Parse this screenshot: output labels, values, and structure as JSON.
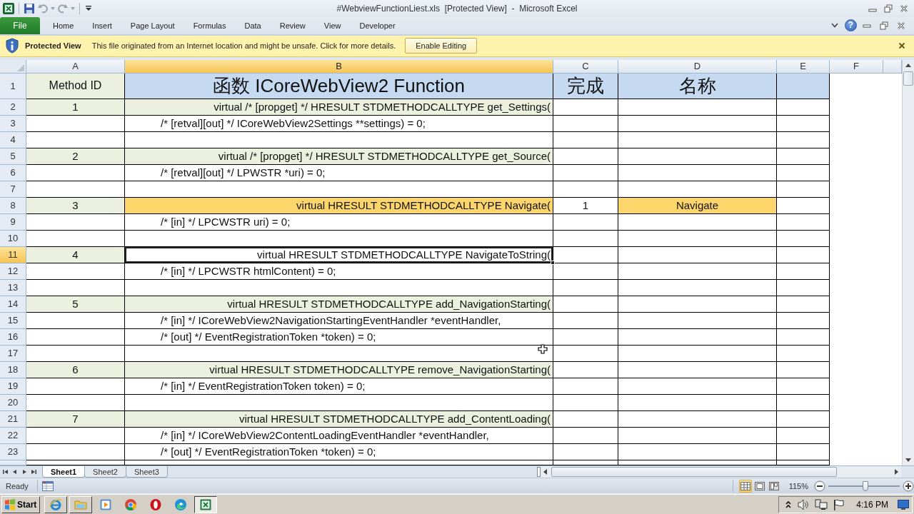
{
  "window": {
    "title": "#WebviewFunctionLiest.xls  [Protected View]  -  Microsoft Excel"
  },
  "ribbon": {
    "file_tab": "File",
    "tabs": [
      "Home",
      "Insert",
      "Page Layout",
      "Formulas",
      "Data",
      "Review",
      "View",
      "Developer"
    ],
    "help": "?"
  },
  "protected_view": {
    "title": "Protected View",
    "message": "This file originated from an Internet location and might be unsafe. Click for more details.",
    "button": "Enable Editing"
  },
  "columns": [
    {
      "label": "A",
      "selected": false
    },
    {
      "label": "B",
      "selected": true
    },
    {
      "label": "C",
      "selected": false
    },
    {
      "label": "D",
      "selected": false
    },
    {
      "label": "E",
      "selected": false
    },
    {
      "label": "F",
      "selected": false
    }
  ],
  "rows": [
    {
      "number": "1",
      "kind": "header",
      "selected": false,
      "highlighted": false,
      "method_id": "Method ID",
      "function": "函数 ICoreWebView2 Function",
      "done": "完成",
      "name": "名称"
    },
    {
      "number": "2",
      "kind": "method",
      "selected": false,
      "highlighted": false,
      "method_id": "1",
      "function": "virtual /* [propget] */ HRESULT STDMETHODCALLTYPE get_Settings("
    },
    {
      "number": "3",
      "kind": "param",
      "selected": false,
      "highlighted": false,
      "function": "/* [retval][out] */ ICoreWebView2Settings **settings) = 0;"
    },
    {
      "number": "4",
      "kind": "blank",
      "selected": false,
      "highlighted": false
    },
    {
      "number": "5",
      "kind": "method",
      "selected": false,
      "highlighted": false,
      "method_id": "2",
      "function": "virtual /* [propget] */ HRESULT STDMETHODCALLTYPE get_Source("
    },
    {
      "number": "6",
      "kind": "param",
      "selected": false,
      "highlighted": false,
      "function": "/* [retval][out] */ LPWSTR *uri) = 0;"
    },
    {
      "number": "7",
      "kind": "blank",
      "selected": false,
      "highlighted": false
    },
    {
      "number": "8",
      "kind": "method",
      "selected": false,
      "highlighted": true,
      "method_id": "3",
      "function": "virtual HRESULT STDMETHODCALLTYPE Navigate(",
      "done": "1",
      "name": "Navigate"
    },
    {
      "number": "9",
      "kind": "param",
      "selected": false,
      "highlighted": false,
      "function": "/* [in] */ LPCWSTR uri) = 0;"
    },
    {
      "number": "10",
      "kind": "blank",
      "selected": false,
      "highlighted": false
    },
    {
      "number": "11",
      "kind": "method",
      "selected": true,
      "highlighted": false,
      "method_id": "4",
      "function": "virtual HRESULT STDMETHODCALLTYPE NavigateToString("
    },
    {
      "number": "12",
      "kind": "param",
      "selected": false,
      "highlighted": false,
      "function": "/* [in] */ LPCWSTR htmlContent) = 0;"
    },
    {
      "number": "13",
      "kind": "blank",
      "selected": false,
      "highlighted": false
    },
    {
      "number": "14",
      "kind": "method",
      "selected": false,
      "highlighted": false,
      "method_id": "5",
      "function": "virtual HRESULT STDMETHODCALLTYPE add_NavigationStarting("
    },
    {
      "number": "15",
      "kind": "param",
      "selected": false,
      "highlighted": false,
      "function": "/* [in] */ ICoreWebView2NavigationStartingEventHandler *eventHandler,"
    },
    {
      "number": "16",
      "kind": "param",
      "selected": false,
      "highlighted": false,
      "function": "/* [out] */ EventRegistrationToken *token) = 0;"
    },
    {
      "number": "17",
      "kind": "blank",
      "selected": false,
      "highlighted": false
    },
    {
      "number": "18",
      "kind": "method",
      "selected": false,
      "highlighted": false,
      "method_id": "6",
      "function": "virtual HRESULT STDMETHODCALLTYPE remove_NavigationStarting("
    },
    {
      "number": "19",
      "kind": "param",
      "selected": false,
      "highlighted": false,
      "function": "/* [in] */ EventRegistrationToken token) = 0;"
    },
    {
      "number": "20",
      "kind": "blank",
      "selected": false,
      "highlighted": false
    },
    {
      "number": "21",
      "kind": "method",
      "selected": false,
      "highlighted": false,
      "method_id": "7",
      "function": "virtual HRESULT STDMETHODCALLTYPE add_ContentLoading("
    },
    {
      "number": "22",
      "kind": "param",
      "selected": false,
      "highlighted": false,
      "function": "/* [in] */ ICoreWebView2ContentLoadingEventHandler *eventHandler,"
    },
    {
      "number": "23",
      "kind": "param",
      "selected": false,
      "highlighted": false,
      "function": "/* [out] */ EventRegistrationToken *token) = 0;"
    }
  ],
  "sheet_tabs": [
    {
      "label": "Sheet1",
      "selected": true
    },
    {
      "label": "Sheet2",
      "selected": false
    },
    {
      "label": "Sheet3",
      "selected": false
    }
  ],
  "status_bar": {
    "status": "Ready",
    "views": [
      {
        "kind": "normal",
        "selected": true
      },
      {
        "kind": "page_layout",
        "selected": false
      },
      {
        "kind": "page_break",
        "selected": false
      }
    ],
    "zoom": "115%",
    "zoom_slider": {
      "level": 0.52
    }
  },
  "taskbar": {
    "start": "Start",
    "apps": [
      {
        "kind": "ie",
        "open": true,
        "selected": false
      },
      {
        "kind": "explorer",
        "open": true,
        "selected": false
      },
      {
        "kind": "media",
        "open": false,
        "selected": false
      },
      {
        "kind": "chrome",
        "open": false,
        "selected": false
      },
      {
        "kind": "opera",
        "open": false,
        "selected": false
      },
      {
        "kind": "edge",
        "open": false,
        "selected": false
      },
      {
        "kind": "excel",
        "open": true,
        "selected": true
      }
    ],
    "clock": "4:16 PM"
  }
}
